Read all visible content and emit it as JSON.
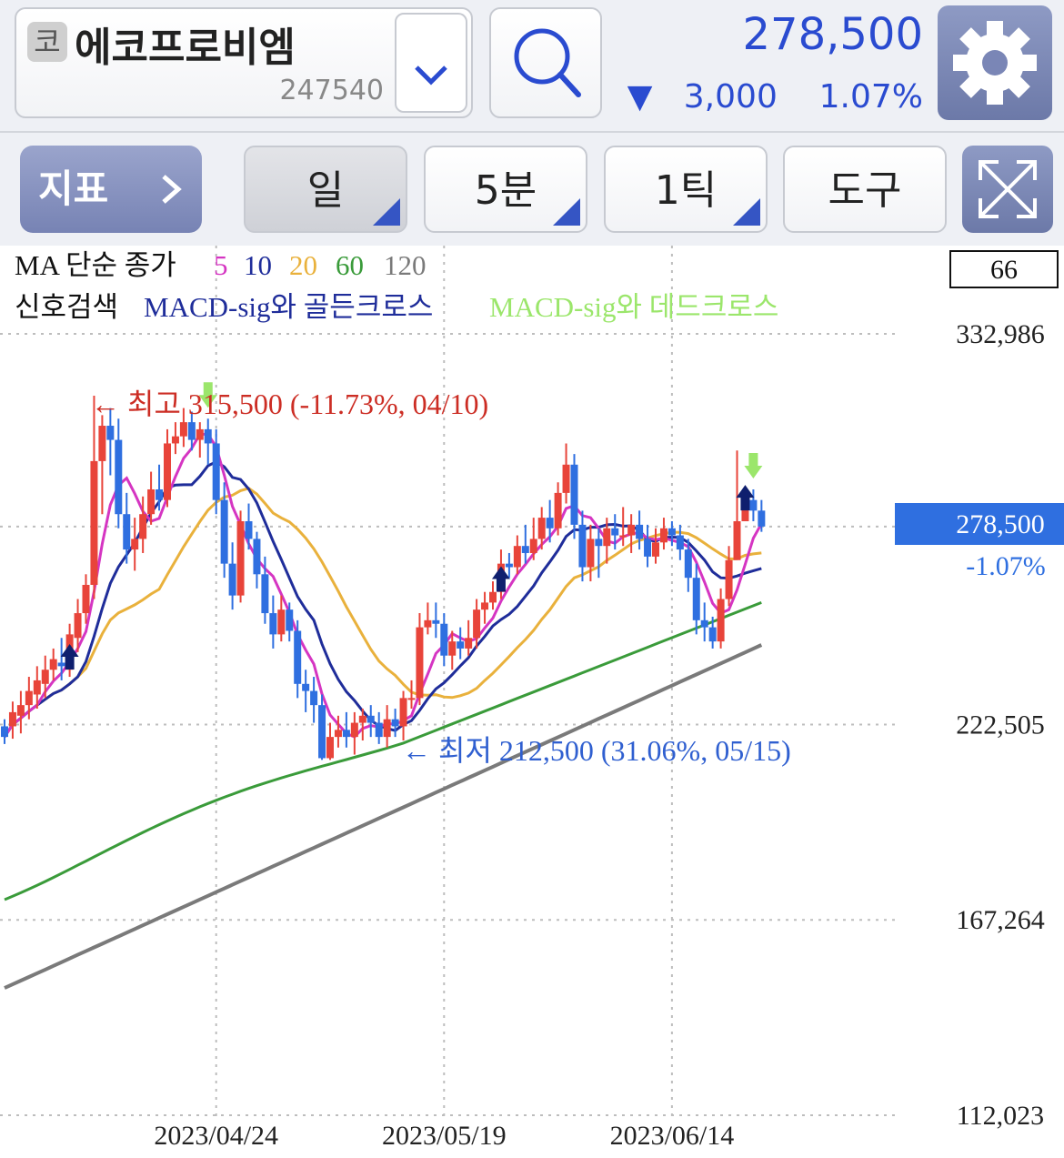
{
  "header": {
    "market_badge": "코",
    "stock_name": "에코프로비엠",
    "stock_code": "247540",
    "price": "278,500",
    "change_arrow": "▼",
    "change_amount": "3,000",
    "change_pct": "1.07%"
  },
  "toolbar": {
    "indicator_label": "지표",
    "period_label": "일",
    "minute_label": "5분",
    "tick_label": "1틱",
    "tools_label": "도구"
  },
  "chart_header": {
    "ma_prefix": "MA 단순 종가",
    "ma_periods": [
      "5",
      "10",
      "20",
      "60",
      "120"
    ],
    "signal_prefix": "신호검색",
    "signal_golden": "MACD-sig와 골든크로스",
    "signal_dead": "MACD-sig와 데드크로스",
    "box_value": "66"
  },
  "colors": {
    "up": "#e8443a",
    "down": "#2f6fe0",
    "ma5": "#d535c2",
    "ma10": "#1f2d9a",
    "ma20": "#e9b13c",
    "ma60": "#3a9b3a",
    "ma120": "#7a7a7a",
    "golden": "#0f1f6e",
    "dead": "#9be66b"
  },
  "chart_data": {
    "type": "candlestick",
    "y_ticks": [
      "332,986",
      "222,505",
      "167,264",
      "112,023"
    ],
    "x_ticks": [
      "2023/04/24",
      "2023/05/19",
      "2023/06/14"
    ],
    "current_price": "278,500",
    "current_change": "-1.07%",
    "high_annotation": "← 최고 315,500 (-11.73%, 04/10)",
    "low_annotation": "← 최저 212,500 (31.06%, 05/15)",
    "candles": [
      [
        222000,
        219000,
        224000,
        217000
      ],
      [
        222000,
        226000,
        229000,
        218500
      ],
      [
        225000,
        228000,
        232000,
        220000
      ],
      [
        228000,
        232000,
        236000,
        224000
      ],
      [
        231000,
        235000,
        239000,
        227000
      ],
      [
        234000,
        238000,
        242000,
        230000
      ],
      [
        238000,
        241000,
        244000,
        235000
      ],
      [
        240000,
        239000,
        247000,
        235000
      ],
      [
        238000,
        248000,
        251000,
        236000
      ],
      [
        247000,
        254000,
        258000,
        243000
      ],
      [
        254000,
        262000,
        265000,
        251000
      ],
      [
        262000,
        297000,
        315500,
        258000
      ],
      [
        297000,
        307000,
        310000,
        282000
      ],
      [
        307000,
        303000,
        312000,
        293000
      ],
      [
        303000,
        282000,
        309000,
        278000
      ],
      [
        282000,
        272000,
        288000,
        268000
      ],
      [
        272000,
        275000,
        281000,
        266000
      ],
      [
        275000,
        282000,
        287000,
        271000
      ],
      [
        282000,
        289000,
        294000,
        279000
      ],
      [
        289000,
        286000,
        296000,
        283000
      ],
      [
        286000,
        302000,
        306000,
        284000
      ],
      [
        302000,
        304000,
        308000,
        299000
      ],
      [
        304000,
        308000,
        312000,
        301000
      ],
      [
        308000,
        303000,
        311000,
        300000
      ],
      [
        303000,
        306000,
        308000,
        298000
      ],
      [
        306000,
        302000,
        309000,
        296000
      ],
      [
        302000,
        286000,
        306000,
        282000
      ],
      [
        286000,
        268000,
        291000,
        264000
      ],
      [
        268000,
        259000,
        274000,
        255000
      ],
      [
        259000,
        280000,
        283000,
        257000
      ],
      [
        280000,
        275000,
        285000,
        272000
      ],
      [
        275000,
        265000,
        277000,
        261000
      ],
      [
        265000,
        254000,
        270000,
        251000
      ],
      [
        254000,
        248000,
        259000,
        244000
      ],
      [
        248000,
        255000,
        259000,
        246000
      ],
      [
        255000,
        249000,
        257000,
        246000
      ],
      [
        249000,
        234000,
        252000,
        230000
      ],
      [
        234000,
        232000,
        238000,
        226000
      ],
      [
        232000,
        228000,
        236000,
        223000
      ],
      [
        228000,
        213000,
        231000,
        212500
      ],
      [
        213000,
        219000,
        223000,
        212500
      ],
      [
        219000,
        221000,
        225000,
        216000
      ],
      [
        221000,
        219000,
        226000,
        216000
      ],
      [
        219000,
        223000,
        226000,
        214000
      ],
      [
        223000,
        225000,
        227000,
        218000
      ],
      [
        225000,
        223000,
        228000,
        219000
      ],
      [
        223000,
        219000,
        226000,
        217000
      ],
      [
        219000,
        224000,
        228000,
        216000
      ],
      [
        224000,
        222000,
        227000,
        219000
      ],
      [
        222000,
        230000,
        232000,
        218000
      ],
      [
        230000,
        230000,
        235000,
        227000
      ],
      [
        230000,
        250000,
        254000,
        228000
      ],
      [
        250000,
        252000,
        257000,
        248000
      ],
      [
        252000,
        251000,
        257000,
        247000
      ],
      [
        251000,
        242000,
        254000,
        239000
      ],
      [
        242000,
        246000,
        249000,
        238000
      ],
      [
        246000,
        244000,
        250000,
        241000
      ],
      [
        244000,
        247000,
        252000,
        242000
      ],
      [
        247000,
        255000,
        258000,
        244000
      ],
      [
        255000,
        257000,
        260000,
        251000
      ],
      [
        257000,
        260000,
        263000,
        255000
      ],
      [
        260000,
        268000,
        272000,
        258000
      ],
      [
        268000,
        267000,
        271000,
        264000
      ],
      [
        267000,
        273000,
        276000,
        265000
      ],
      [
        273000,
        271000,
        279000,
        268000
      ],
      [
        271000,
        275000,
        281000,
        269000
      ],
      [
        275000,
        281000,
        284000,
        272000
      ],
      [
        281000,
        278000,
        286000,
        274000
      ],
      [
        278000,
        288000,
        291000,
        276000
      ],
      [
        288000,
        296000,
        302000,
        285000
      ],
      [
        296000,
        279000,
        299000,
        275000
      ],
      [
        279000,
        267000,
        283000,
        263000
      ],
      [
        267000,
        275000,
        279000,
        263000
      ],
      [
        275000,
        273000,
        278000,
        264000
      ],
      [
        273000,
        278000,
        281000,
        268000
      ],
      [
        278000,
        276000,
        282000,
        272000
      ],
      [
        276000,
        276000,
        284000,
        273000
      ],
      [
        276000,
        279000,
        282000,
        271000
      ],
      [
        279000,
        275000,
        283000,
        272000
      ],
      [
        275000,
        270000,
        279000,
        267000
      ],
      [
        270000,
        274000,
        278000,
        268000
      ],
      [
        274000,
        278000,
        281000,
        272000
      ],
      [
        278000,
        276000,
        280000,
        273000
      ],
      [
        276000,
        272000,
        279000,
        269000
      ],
      [
        272000,
        264000,
        275000,
        260000
      ],
      [
        264000,
        252000,
        268000,
        248000
      ],
      [
        252000,
        250000,
        257000,
        246000
      ],
      [
        250000,
        246000,
        253000,
        244000
      ],
      [
        246000,
        258000,
        261000,
        244000
      ],
      [
        258000,
        269000,
        273000,
        256000
      ],
      [
        269000,
        280000,
        300000,
        275000
      ],
      [
        280000,
        286000,
        288000,
        281000
      ],
      [
        286000,
        283000,
        289000,
        280000
      ],
      [
        283000,
        278500,
        286000,
        277000
      ]
    ]
  }
}
